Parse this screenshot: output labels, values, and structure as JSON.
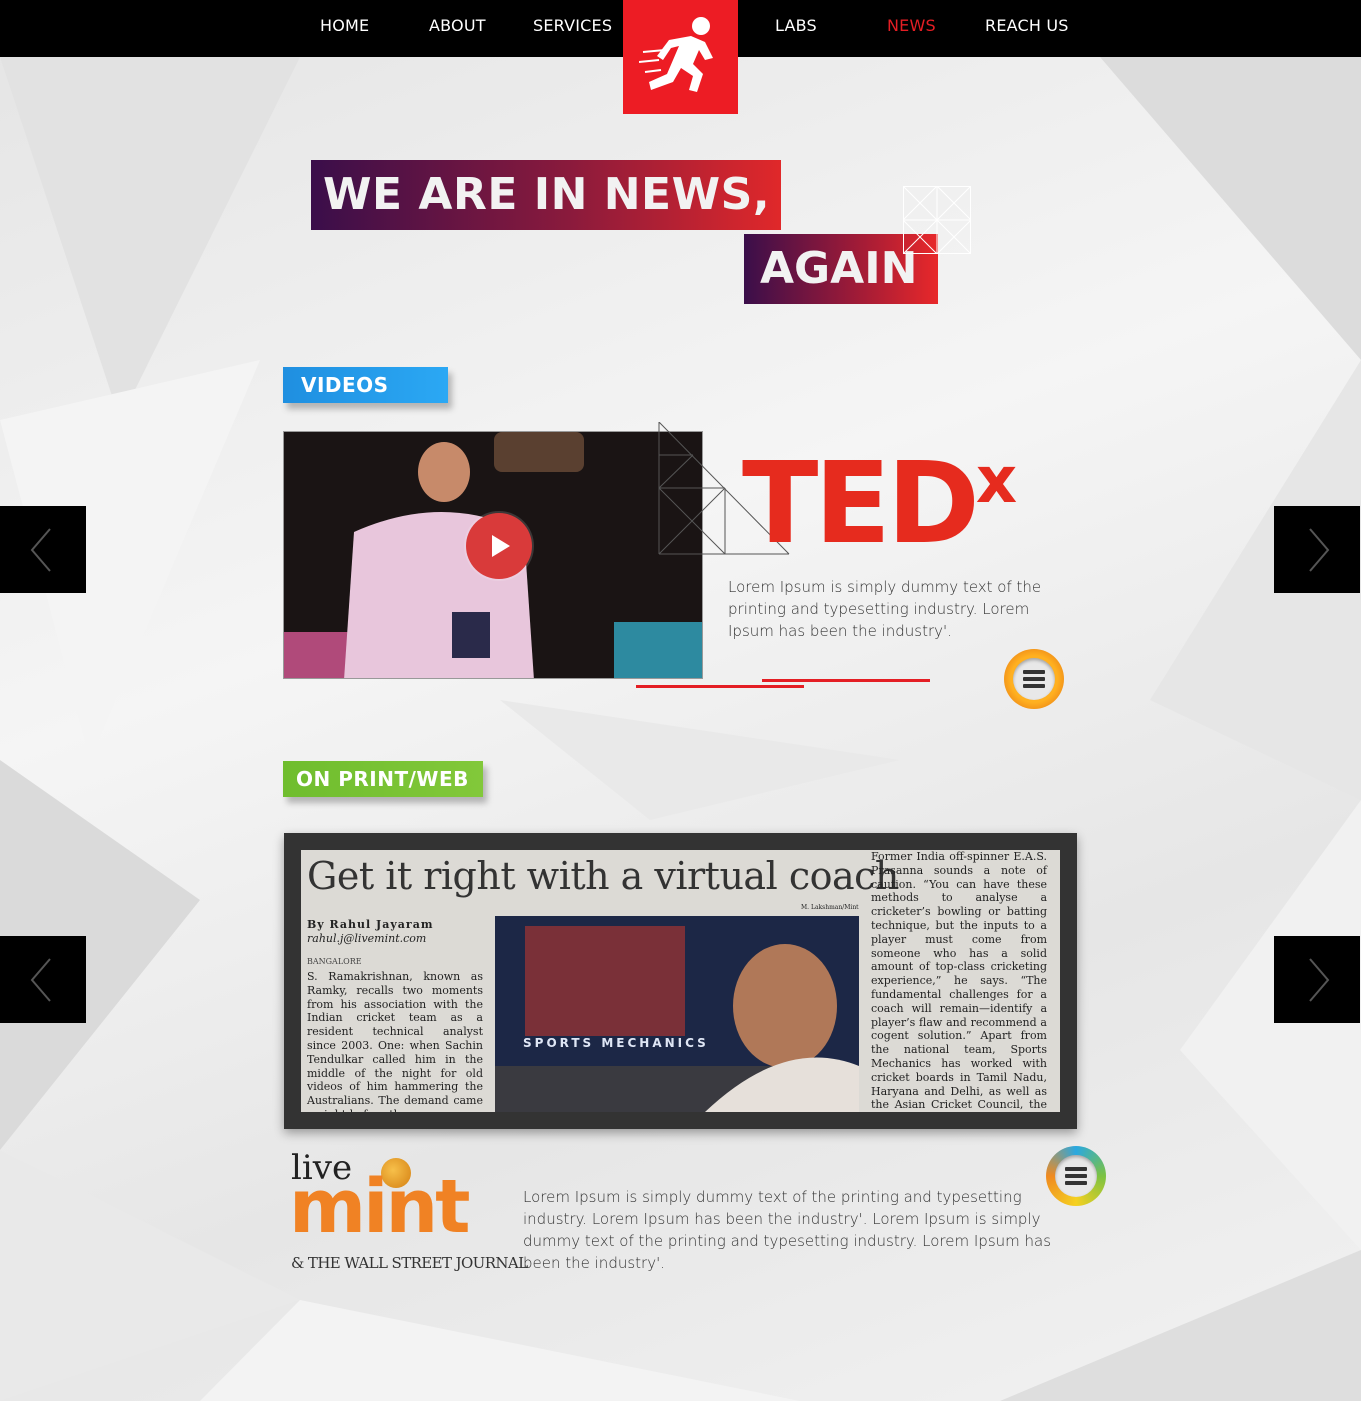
{
  "nav": {
    "items": [
      {
        "label": "HOME"
      },
      {
        "label": "ABOUT"
      },
      {
        "label": "SERVICES"
      },
      {
        "label": "LABS"
      },
      {
        "label": "NEWS"
      },
      {
        "label": "REACH US"
      }
    ],
    "active": "NEWS",
    "logo_icon": "running-man-icon"
  },
  "hero": {
    "line1": "WE ARE IN NEWS,",
    "line2": "AGAIN"
  },
  "videos": {
    "section_label": "VIDEOS",
    "brand": "TED",
    "brand_sup": "x",
    "description": "Lorem Ipsum is simply dummy text of the printing and typesetting industry. Lorem Ipsum has been the industry'."
  },
  "print": {
    "section_label": "ON PRINT/WEB",
    "article": {
      "headline": "Get it right with a virtual coach",
      "byline": "By Rahul Jayaram",
      "email": "rahul.j@livemint.com",
      "dateline": "BANGALORE",
      "photo_credit": "M. Lakshman/Mint",
      "photo_sign": "SPORTS MECHANICS",
      "col_left": "S. Ramakrishnan, known as Ramky, recalls two moments from his association with the Indian cricket team as a resident technical analyst since 2003. One: when Sachin Tendulkar called him in the middle of the night for old videos of him hammering the Australians. The demand came a night before the",
      "col_right": "Former India off-spinner E.A.S. Prasanna sounds a note of caution. “You can have these methods to analyse a cricketer’s bowling or batting technique, but the inputs to a player must come from someone who has a solid amount of top-class cricketing experience,” he says. “The fundamental challenges for a coach will remain—identify a player’s flaw and recommend a cogent solution.” Apart from the national team, Sports Mechanics has worked with cricket boards in Tamil Nadu, Haryana and Delhi, as well as the Asian Cricket Council, the International Cricket"
    },
    "publisher": {
      "live": "live",
      "mint": "mint",
      "tagline": "& THE WALL STREET JOURNAL"
    },
    "description": "Lorem Ipsum is simply dummy text of the printing and typesetting industry. Lorem Ipsum has been the industry'. Lorem Ipsum is simply dummy text of the printing and typesetting industry. Lorem Ipsum has been the industry'."
  },
  "colors": {
    "nav_bg": "#000000",
    "accent_red": "#ed1c24",
    "videos_tag": "#2ba8f4",
    "print_tag": "#7cc242",
    "tedx_red": "#e62b1e",
    "mint_orange": "#f08224"
  },
  "icons": {
    "play": "play-icon",
    "menu": "menu-icon",
    "prev": "chevron-left-icon",
    "next": "chevron-right-icon"
  }
}
